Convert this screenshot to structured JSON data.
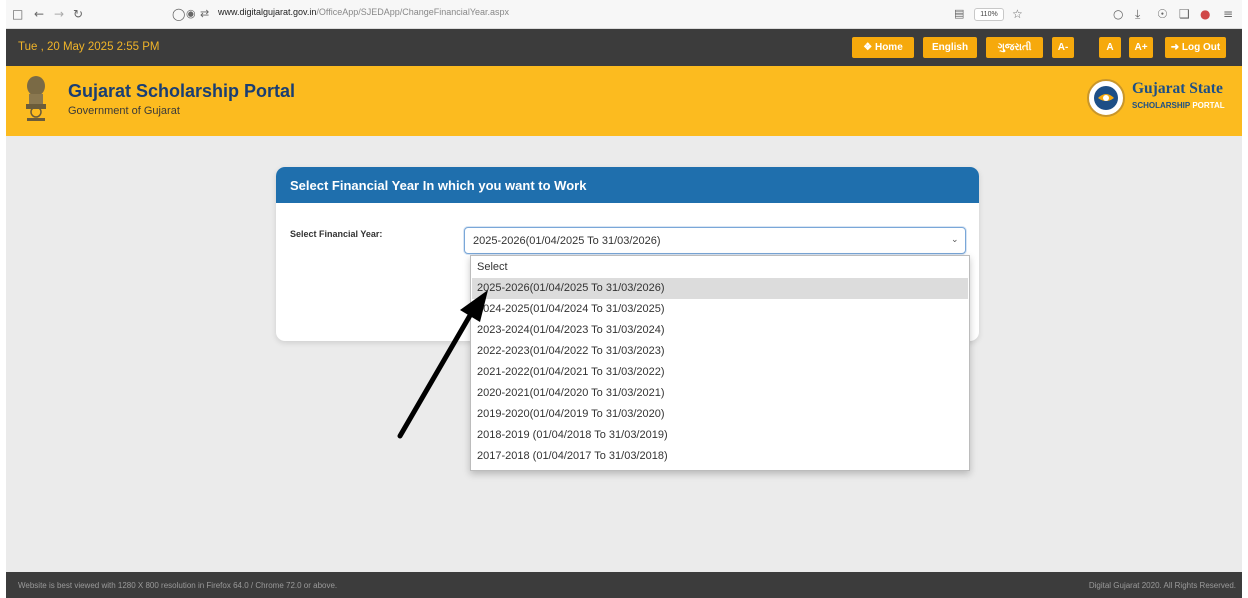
{
  "browser": {
    "url_host": "www.digitalgujarat.gov.in",
    "url_path": "/OfficeApp/SJEDApp/ChangeFinancialYear.aspx",
    "zoom": "110%",
    "icons": [
      "sidebar-icon",
      "back-icon",
      "forward-icon",
      "reload-icon",
      "shield-icon",
      "lock-icon",
      "permissions-icon",
      "reader-icon",
      "bookmark-star-icon",
      "pocket-icon",
      "download-icon",
      "account-icon",
      "extensions-icon",
      "app-icon",
      "menu-icon"
    ]
  },
  "top_bar": {
    "datetime": "Tue , 20 May 2025 2:55 PM",
    "buttons": {
      "home": "Home",
      "english": "English",
      "gujarati": "ગુજરાતી",
      "font_decrease": "A-",
      "font_normal": "A",
      "font_increase": "A+",
      "logout": "Log Out"
    }
  },
  "header": {
    "title": "Gujarat Scholarship Portal",
    "subtitle": "Government of Gujarat",
    "logo_title": "Gujarat State",
    "logo_sub_1": "SCHOLARSHIP",
    "logo_sub_2": "PORTAL"
  },
  "card": {
    "title": "Select Financial Year In which you want to Work",
    "label": "Select Financial Year:",
    "selected_value": "2025-2026(01/04/2025 To 31/03/2026)"
  },
  "dropdown": {
    "options": [
      "Select",
      "2025-2026(01/04/2025 To 31/03/2026)",
      "2024-2025(01/04/2024 To 31/03/2025)",
      "2023-2024(01/04/2023 To 31/03/2024)",
      "2022-2023(01/04/2022 To 31/03/2023)",
      "2021-2022(01/04/2021 To 31/03/2022)",
      "2020-2021(01/04/2020 To 31/03/2021)",
      "2019-2020(01/04/2019 To 31/03/2020)",
      "2018-2019 (01/04/2018 To 31/03/2019)",
      "2017-2018 (01/04/2017 To 31/03/2018)"
    ],
    "highlighted_index": 1
  },
  "footer": {
    "left": "Website is best viewed with 1280 X 800 resolution in Firefox 64.0 / Chrome 72.0 or above.",
    "right": "Digital Gujarat 2020. All Rights Reserved."
  },
  "colors": {
    "top_strip": "#3c3c3c",
    "header_bg": "#fcbb1f",
    "button_orange": "#f6a90c",
    "card_header": "#1f6fad",
    "title_blue": "#1a3e73",
    "datetime": "#f0b429"
  }
}
